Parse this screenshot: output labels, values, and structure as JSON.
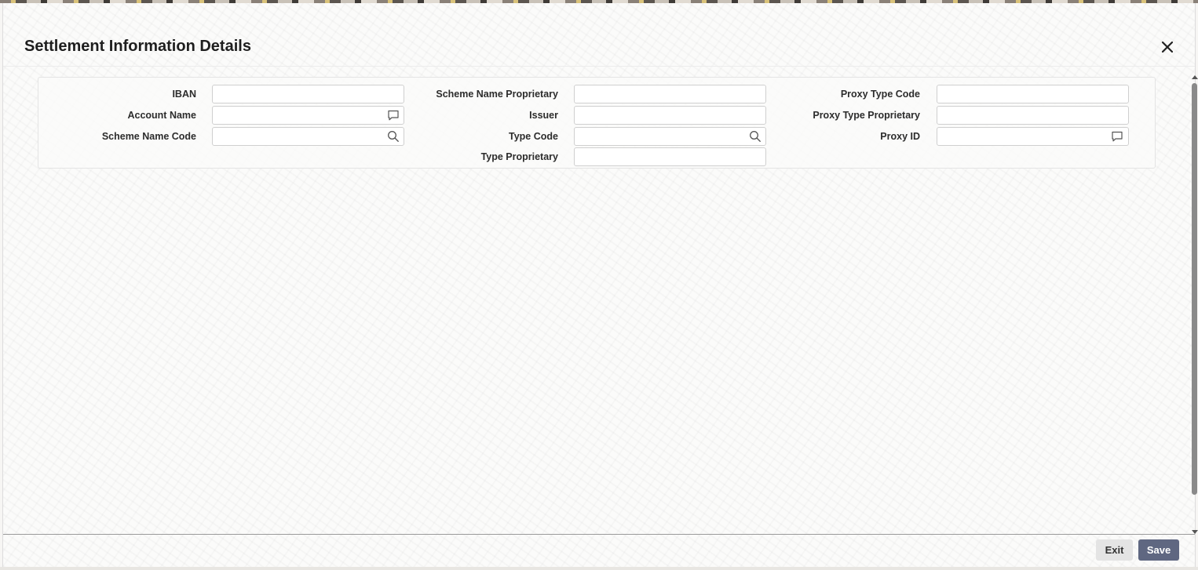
{
  "dialog": {
    "title": "Settlement Information Details",
    "close_icon": "close-icon"
  },
  "form": {
    "column1": [
      {
        "label": "IBAN",
        "value": "",
        "icon": null
      },
      {
        "label": "Account Name",
        "value": "",
        "icon": "comment-icon"
      },
      {
        "label": "Scheme Name Code",
        "value": "",
        "icon": "search-icon"
      }
    ],
    "column2": [
      {
        "label": "Scheme Name Proprietary",
        "value": "",
        "icon": null
      },
      {
        "label": "Issuer",
        "value": "",
        "icon": null
      },
      {
        "label": "Type Code",
        "value": "",
        "icon": "search-icon"
      },
      {
        "label": "Type Proprietary",
        "value": "",
        "icon": null
      }
    ],
    "column3": [
      {
        "label": "Proxy Type Code",
        "value": "",
        "icon": null
      },
      {
        "label": "Proxy Type Proprietary",
        "value": "",
        "icon": null
      },
      {
        "label": "Proxy ID",
        "value": "",
        "icon": "comment-icon"
      }
    ]
  },
  "footer": {
    "exit_label": "Exit",
    "save_label": "Save"
  },
  "colors": {
    "save_button": "#5f6781",
    "exit_button": "#e4e4e4"
  }
}
